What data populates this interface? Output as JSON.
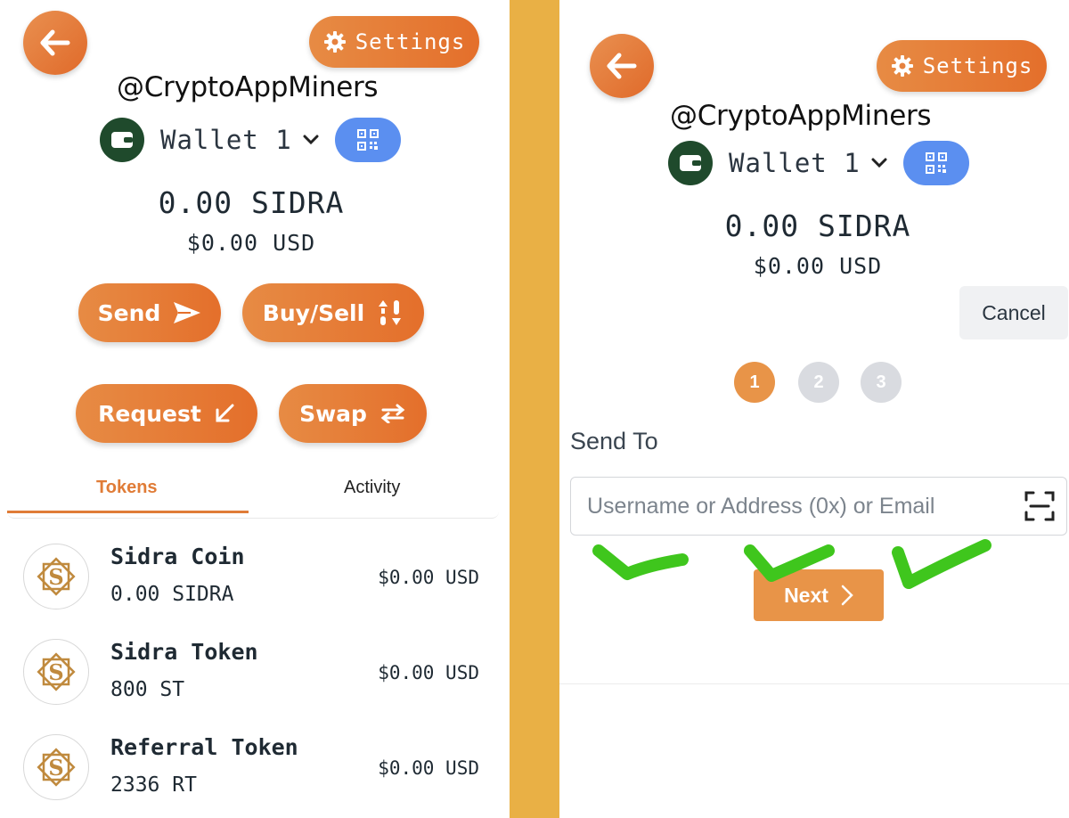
{
  "watermark": "@CryptoAppMiners",
  "settings_label": "Settings",
  "wallet": {
    "name": "Wallet 1"
  },
  "balance": {
    "primary": "0.00 SIDRA",
    "usd": "$0.00 USD"
  },
  "actions": {
    "send": "Send",
    "buy_sell": "Buy/Sell",
    "request": "Request",
    "swap": "Swap"
  },
  "tabs": {
    "tokens": "Tokens",
    "activity": "Activity"
  },
  "tokens": [
    {
      "name": "Sidra Coin",
      "amount": "0.00 SIDRA",
      "usd": "$0.00 USD"
    },
    {
      "name": "Sidra Token",
      "amount": "800 ST",
      "usd": "$0.00 USD"
    },
    {
      "name": "Referral Token",
      "amount": "2336 RT",
      "usd": "$0.00 USD"
    }
  ],
  "send_flow": {
    "cancel_label": "Cancel",
    "steps": [
      "1",
      "2",
      "3"
    ],
    "active_step": 1,
    "send_to_label": "Send To",
    "address_placeholder": "Username or Address (0x) or Email",
    "next_label": "Next"
  },
  "colors": {
    "accent_orange": "#e46f2b",
    "qr_blue": "#5b8ff0",
    "wallet_green": "#1f4a2c",
    "divider_gold": "#e9b045",
    "check_green": "#3fc61d"
  },
  "icons": {
    "back": "arrow-left-icon",
    "settings": "gear-icon",
    "wallet": "wallet-icon",
    "qr": "qr-code-icon",
    "send": "send-plane-icon",
    "buy_sell": "up-down-arrows-icon",
    "request": "arrow-down-left-icon",
    "swap": "swap-arrows-icon",
    "token_logo": "sidra-logo-icon",
    "scan": "scan-icon",
    "next": "chevron-right-icon"
  }
}
